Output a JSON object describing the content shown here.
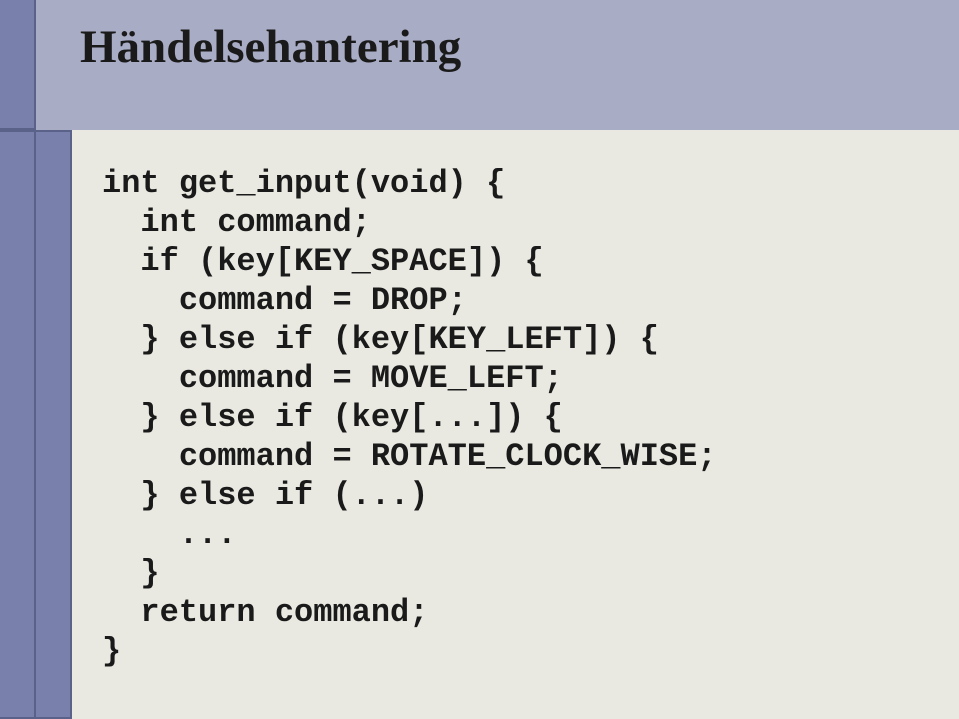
{
  "title": "Händelsehantering",
  "code": {
    "l1": "int get_input(void) {",
    "l2": "  int command;",
    "l3": "  if (key[KEY_SPACE]) {",
    "l4": "    command = DROP;",
    "l5": "  } else if (key[KEY_LEFT]) {",
    "l6": "    command = MOVE_LEFT;",
    "l7": "  } else if (key[...]) {",
    "l8": "    command = ROTATE_CLOCK_WISE;",
    "l9": "  } else if (...)",
    "l10": "    ...",
    "l11": "  }",
    "l12": "  return command;",
    "l13": "}"
  }
}
